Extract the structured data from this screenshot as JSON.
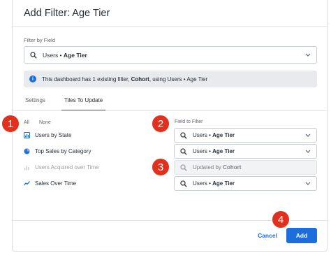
{
  "dialog": {
    "title": "Add Filter: Age Tier",
    "filter_by_field_label": "Filter by Field",
    "field_select": {
      "prefix": "Users • ",
      "value": "Age Tier"
    },
    "info": {
      "text_before": "This dashboard has 1 existing filter, ",
      "filter_name": "Cohort",
      "text_after": ", using Users • Age Tier"
    },
    "tabs": [
      {
        "label": "Settings",
        "active": false
      },
      {
        "label": "Tiles To Update",
        "active": true
      }
    ],
    "tiles_header": {
      "all": "All",
      "none": "None",
      "field_to_filter": "Field to Filter"
    },
    "tiles": [
      {
        "label": "Users by State",
        "icon": "bar-chart-icon",
        "enabled": true,
        "field_prefix": "Users • ",
        "field_value": "Age Tier"
      },
      {
        "label": "Top Sales by Category",
        "icon": "pie-chart-icon",
        "enabled": true,
        "field_prefix": "Users • ",
        "field_value": "Age Tier"
      },
      {
        "label": "Users Acquired over Time",
        "icon": "column-chart-icon",
        "enabled": false,
        "field_prefix": "Updated by ",
        "field_value": "Cohort"
      },
      {
        "label": "Sales Over Time",
        "icon": "line-chart-icon",
        "enabled": true,
        "field_prefix": "Users • ",
        "field_value": "Age Tier"
      }
    ],
    "footer": {
      "cancel_label": "Cancel",
      "add_label": "Add"
    }
  },
  "markers": [
    "1",
    "2",
    "3",
    "4"
  ],
  "colors": {
    "accent": "#1e6ddc",
    "marker": "#e0301e",
    "banner": "#e8eaed"
  }
}
